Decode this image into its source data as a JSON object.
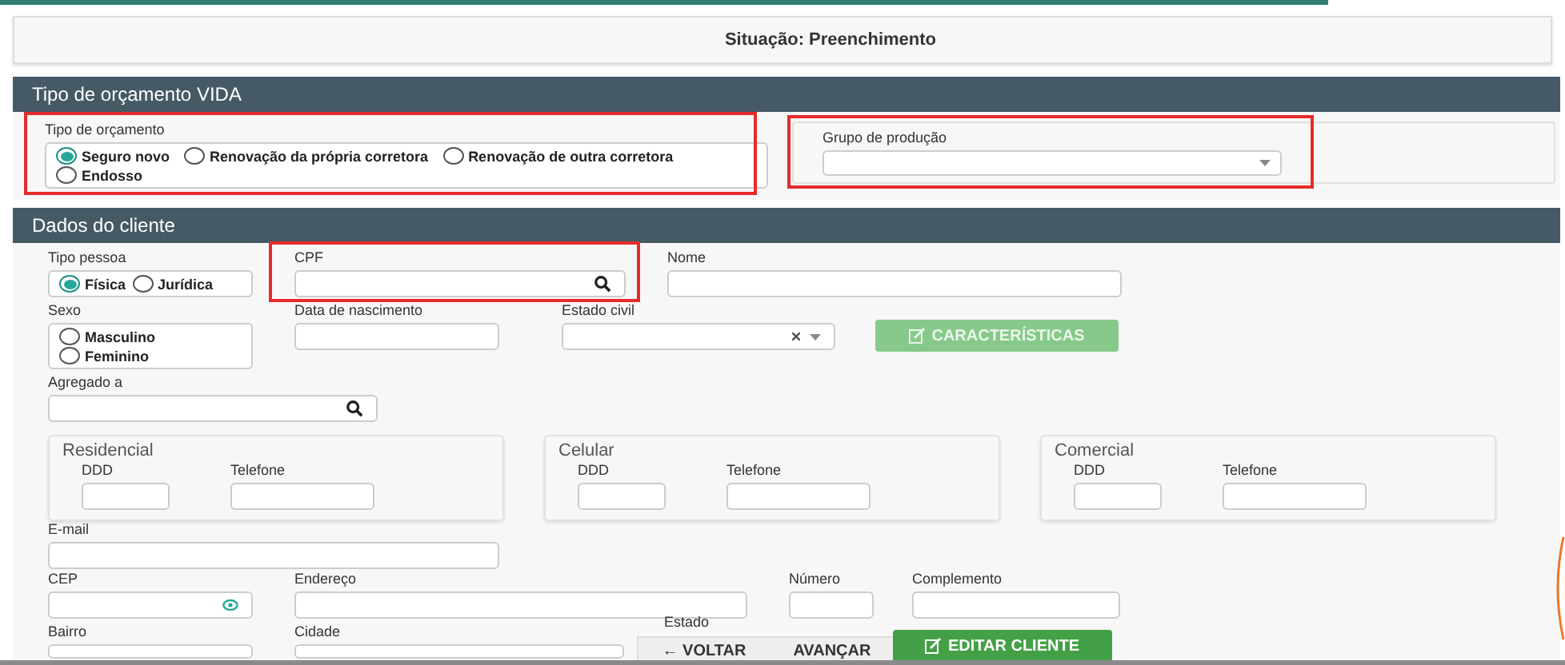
{
  "status": "Situação: Preenchimento",
  "budget_section": {
    "title": "Tipo de orçamento VIDA",
    "budget_type": {
      "label": "Tipo de orçamento",
      "options": [
        {
          "label": "Seguro novo",
          "selected": true
        },
        {
          "label": "Renovação da própria corretora",
          "selected": false
        },
        {
          "label": "Renovação de outra corretora",
          "selected": false
        },
        {
          "label": "Endosso",
          "selected": false
        }
      ]
    },
    "production_group": {
      "label": "Grupo de produção"
    }
  },
  "client_section": {
    "title": "Dados do cliente",
    "person_type": {
      "label": "Tipo pessoa",
      "options": [
        {
          "label": "Física",
          "selected": true
        },
        {
          "label": "Jurídica",
          "selected": false
        }
      ]
    },
    "cpf": {
      "label": "CPF"
    },
    "name": {
      "label": "Nome"
    },
    "sex": {
      "label": "Sexo",
      "options": [
        {
          "label": "Masculino",
          "selected": false
        },
        {
          "label": "Feminino",
          "selected": false
        }
      ]
    },
    "birth_date": {
      "label": "Data de nascimento"
    },
    "marital_status": {
      "label": "Estado civil"
    },
    "characteristics_button": {
      "label": "CARACTERÍSTICAS",
      "disabled": true
    },
    "aggregate": {
      "label": "Agregado a"
    },
    "phones": [
      {
        "title": "Residencial",
        "ddd_label": "DDD",
        "phone_label": "Telefone"
      },
      {
        "title": "Celular",
        "ddd_label": "DDD",
        "phone_label": "Telefone"
      },
      {
        "title": "Comercial",
        "ddd_label": "DDD",
        "phone_label": "Telefone"
      }
    ],
    "email": {
      "label": "E-mail"
    },
    "cep": {
      "label": "CEP"
    },
    "address": {
      "label": "Endereço"
    },
    "number": {
      "label": "Número"
    },
    "complement": {
      "label": "Complemento"
    },
    "district": {
      "label": "Bairro"
    },
    "city": {
      "label": "Cidade"
    },
    "state": {
      "label": "Estado"
    }
  },
  "navigation": {
    "back": "← VOLTAR",
    "forward": "AVANÇAR"
  },
  "edit_client_button": {
    "label": "EDITAR CLIENTE",
    "disabled": false
  }
}
